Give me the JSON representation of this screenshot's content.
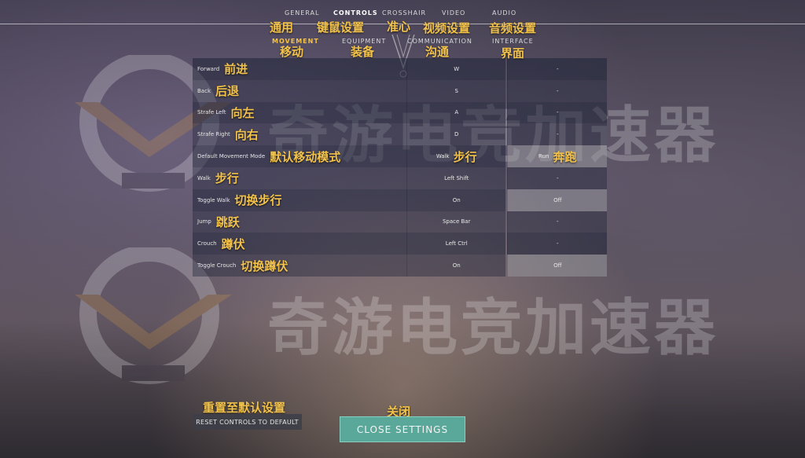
{
  "watermark": {
    "text": "奇游电竞加速器"
  },
  "header": {
    "tabs_row1": [
      {
        "label": "GENERAL",
        "cn": "通用"
      },
      {
        "label": "CONTROLS",
        "cn": "键鼠设置",
        "active": true
      },
      {
        "label": "CROSSHAIR",
        "cn": "准心"
      },
      {
        "label": "VIDEO",
        "cn": "视频设置"
      },
      {
        "label": "AUDIO",
        "cn": "音频设置"
      }
    ],
    "tabs_row2": [
      {
        "label": "MOVEMENT",
        "cn": "移动",
        "active": true
      },
      {
        "label": "EQUIPMENT",
        "cn": "装备"
      },
      {
        "label": "COMMUNICATION",
        "cn": "沟通"
      },
      {
        "label": "INTERFACE",
        "cn": "界面"
      }
    ]
  },
  "bindings": [
    {
      "en": "Forward",
      "cn": "前进",
      "primary": "W",
      "secondary": "-"
    },
    {
      "en": "Back",
      "cn": "后退",
      "primary": "S",
      "secondary": "-"
    },
    {
      "en": "Strafe Left",
      "cn": "向左",
      "primary": "A",
      "secondary": "-"
    },
    {
      "en": "Strafe Right",
      "cn": "向右",
      "primary": "D",
      "secondary": "-"
    },
    {
      "en": "Default Movement Mode",
      "cn": "默认移动模式",
      "primary": "Walk",
      "primary_cn": "步行",
      "secondary": "Run",
      "secondary_cn": "奔跑"
    },
    {
      "en": "Walk",
      "cn": "步行",
      "primary": "Left Shift",
      "secondary": "-"
    },
    {
      "en": "Toggle Walk",
      "cn": "切换步行",
      "primary": "On",
      "secondary": "Off"
    },
    {
      "en": "Jump",
      "cn": "跳跃",
      "primary": "Space Bar",
      "secondary": "-"
    },
    {
      "en": "Crouch",
      "cn": "蹲伏",
      "primary": "Left Ctrl",
      "secondary": "-"
    },
    {
      "en": "Toggle Crouch",
      "cn": "切换蹲伏",
      "primary": "On",
      "secondary": "Off"
    }
  ],
  "footer": {
    "reset_cn": "重置至默认设置",
    "reset_label": "RESET CONTROLS TO DEFAULT",
    "close_cn": "关闭",
    "close_label": "CLOSE SETTINGS"
  },
  "colors": {
    "accent_gold": "#f2c24a",
    "close_button": "#5aa89a"
  }
}
